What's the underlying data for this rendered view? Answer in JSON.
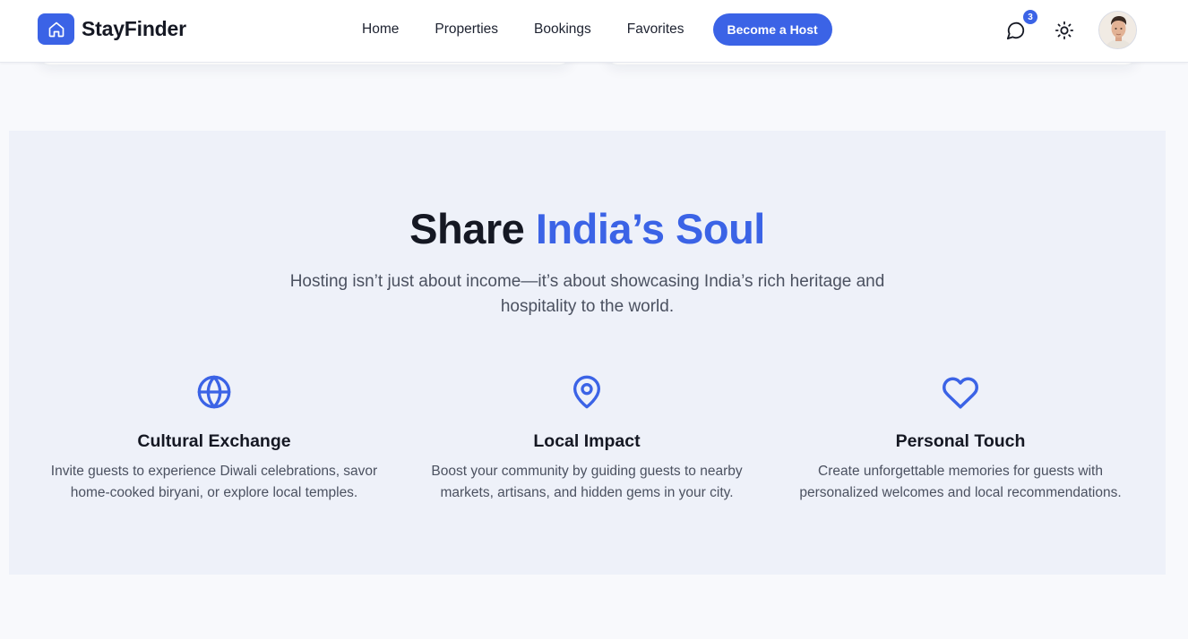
{
  "header": {
    "brand": "StayFinder",
    "nav": [
      "Home",
      "Properties",
      "Bookings",
      "Favorites"
    ],
    "host_button": "Become a Host",
    "chat_badge": "3",
    "icons": {
      "logo": "home-icon",
      "chat": "chat-bubble-icon",
      "theme": "sun-icon",
      "avatar": "user-avatar"
    }
  },
  "hero": {
    "title_prefix": "Share",
    "title_accent": "India’s Soul",
    "subtitle": "Hosting isn’t just about income—it’s about showcasing India’s rich heritage and hospitality to the world."
  },
  "features": [
    {
      "icon": "globe-icon",
      "title": "Cultural Exchange",
      "text": "Invite guests to experience Diwali celebrations, savor home-cooked biryani, or explore local temples."
    },
    {
      "icon": "map-pin-icon",
      "title": "Local Impact",
      "text": "Boost your community by guiding guests to nearby markets, artisans, and hidden gems in your city."
    },
    {
      "icon": "heart-icon",
      "title": "Personal Touch",
      "text": "Create unforgettable memories for guests with personalized welcomes and local recommendations."
    }
  ],
  "colors": {
    "accent": "#3b63e6",
    "section_bg": "#eef1f9",
    "page_bg": "#f8f9fc"
  }
}
